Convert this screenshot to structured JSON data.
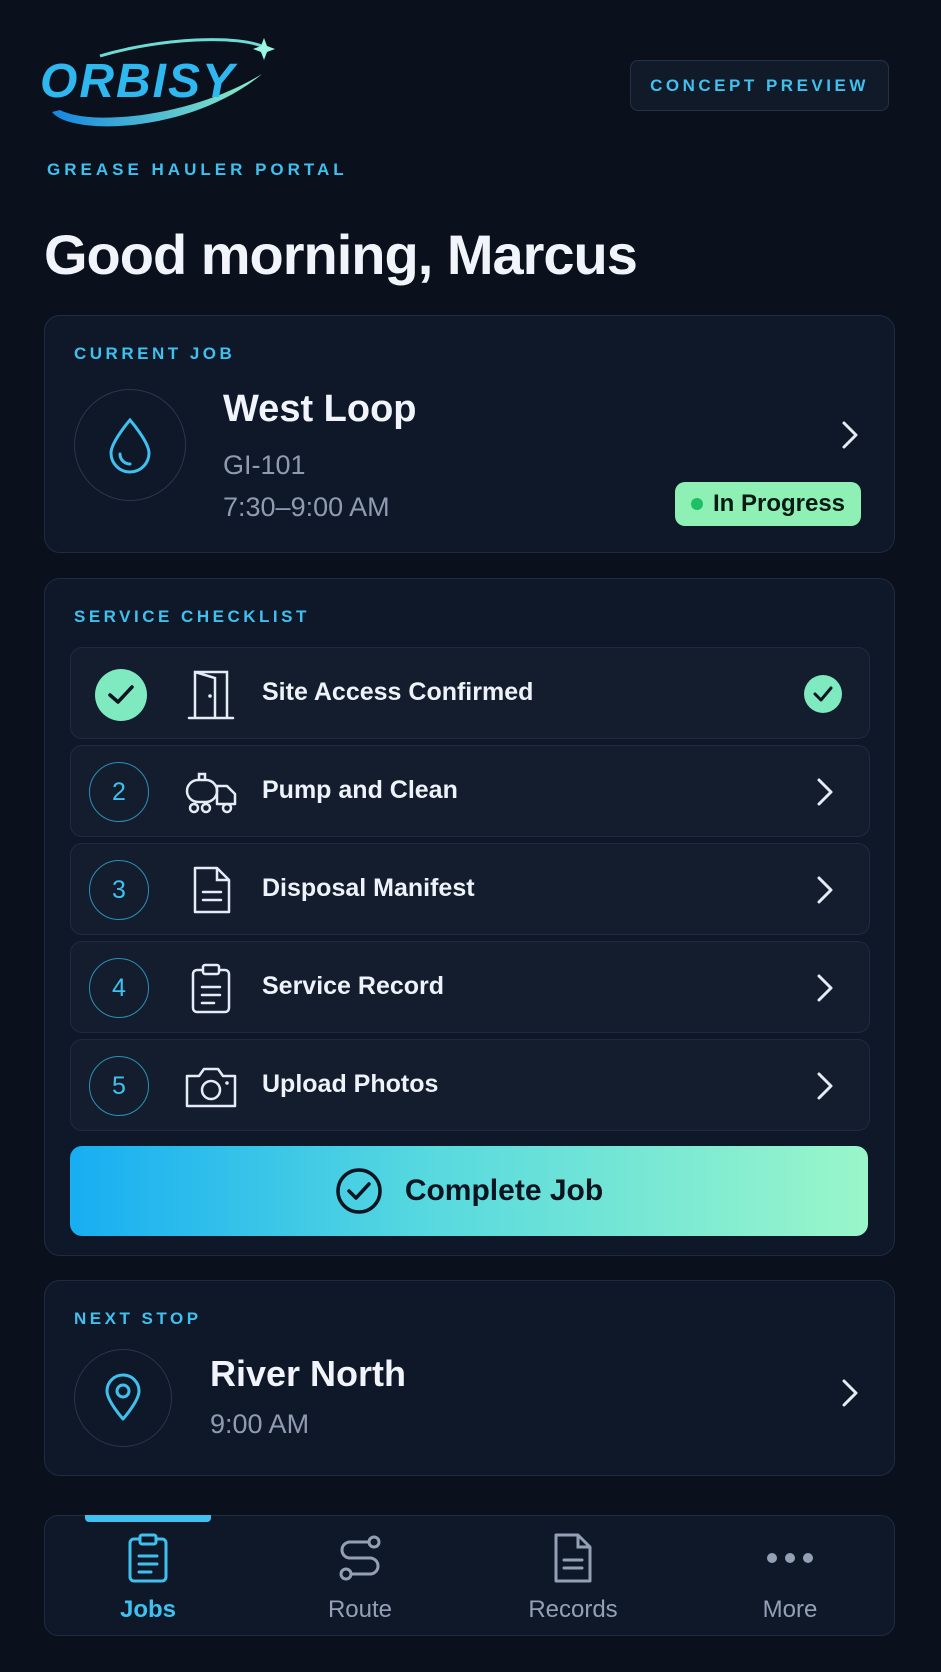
{
  "brand": {
    "logo_text": "ORBISY",
    "portal_label": "GREASE HAULER PORTAL",
    "badge": "CONCEPT PREVIEW"
  },
  "greeting": "Good morning, Marcus",
  "current_job": {
    "section_label": "CURRENT JOB",
    "title": "West Loop",
    "job_id": "GI-101",
    "time_window": "7:30–9:00 AM",
    "status": "In Progress",
    "icon": "water-drop-icon"
  },
  "checklist": {
    "section_label": "SERVICE CHECKLIST",
    "items": [
      {
        "step": "1",
        "label": "Site Access Confirmed",
        "icon": "door-icon",
        "done": true
      },
      {
        "step": "2",
        "label": "Pump and Clean",
        "icon": "tanker-truck-icon",
        "done": false
      },
      {
        "step": "3",
        "label": "Disposal Manifest",
        "icon": "document-icon",
        "done": false
      },
      {
        "step": "4",
        "label": "Service Record",
        "icon": "clipboard-icon",
        "done": false
      },
      {
        "step": "5",
        "label": "Upload Photos",
        "icon": "camera-icon",
        "done": false
      }
    ],
    "complete_label": "Complete Job"
  },
  "next_stop": {
    "section_label": "NEXT STOP",
    "title": "River North",
    "time": "9:00 AM",
    "icon": "map-pin-icon"
  },
  "nav": {
    "items": [
      {
        "label": "Jobs",
        "icon": "clipboard-icon",
        "active": true
      },
      {
        "label": "Route",
        "icon": "route-icon",
        "active": false
      },
      {
        "label": "Records",
        "icon": "document-icon",
        "active": false
      },
      {
        "label": "More",
        "icon": "more-dots-icon",
        "active": false
      }
    ]
  },
  "colors": {
    "background": "#0a111d",
    "accent": "#3fc0ee",
    "success": "#8ef0b4"
  }
}
